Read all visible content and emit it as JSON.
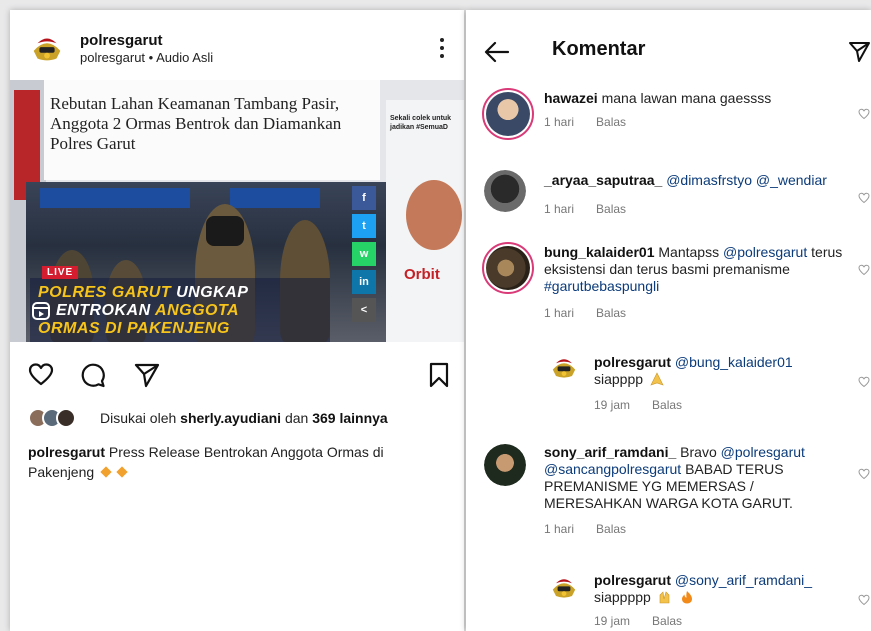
{
  "post": {
    "username": "polresgarut",
    "subtitle": "polresgarut • Audio Asli",
    "image": {
      "headline": "Rebutan Lahan Keamanan Tambang Pasir, Anggota 2 Ormas Bentrok dan Diamankan Polres Garut",
      "side_text": "Sekali colek untuk jadikan #SemuaD",
      "orbit": "Orbit",
      "live": "LIVE",
      "caption_line1_a": "POLRES GARUT",
      "caption_line1_b": " UNGKAP",
      "caption_line2_a": "ENTROKAN ",
      "caption_line2_b": "ANGGOTA",
      "caption_line3": "ORMAS DI PAKENJENG"
    },
    "likes": {
      "prefix": "Disukai oleh ",
      "user": "sherly.ayudiani",
      "middle": " dan ",
      "count": "369 lainnya"
    },
    "caption": {
      "user": "polresgarut",
      "text": " Press Release Bentrokan Anggota Ormas di Pakenjeng"
    }
  },
  "comments_panel": {
    "title": "Komentar",
    "reply_label": "Balas",
    "comments": [
      {
        "user": "hawazei",
        "text": " mana lawan mana gaessss",
        "time": "1 hari"
      },
      {
        "user": "_aryaa_saputraa_",
        "mention": " @dimasfrstyo @_wendiar",
        "time": "1 hari"
      },
      {
        "user": "bung_kalaider01",
        "text": " Mantapss ",
        "mention": "@polresgarut",
        "text2": " terus eksistensi dan terus basmi premanisme ",
        "tag": "#garutbebaspungli",
        "time": "1 hari"
      },
      {
        "user": "polresgarut",
        "mention": " @bung_kalaider01",
        "text": " siapppp",
        "time": "19 jam"
      },
      {
        "user": "sony_arif_ramdani_",
        "text": " Bravo ",
        "mention": "@polresgarut",
        "mention2": "@sancangpolresgarut",
        "text2": "  BABAD TERUS PREMANISME YG MEMERSAS / MERESAHKAN WARGA KOTA GARUT.",
        "time": "1 hari"
      },
      {
        "user": "polresgarut",
        "mention": " @sony_arif_ramdani_",
        "text": " siappppp",
        "time": "19 jam"
      }
    ]
  },
  "colors": {
    "mention": "#0b3b7a",
    "accent_red": "#d41d2f",
    "gold": "#f6c41a",
    "ring": "#d93a78"
  }
}
